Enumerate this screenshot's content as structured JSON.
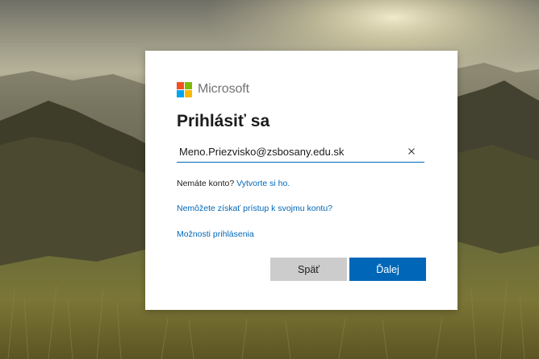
{
  "brand": {
    "name": "Microsoft",
    "logo_colors": [
      "#f25022",
      "#7fba00",
      "#00a4ef",
      "#ffb900"
    ]
  },
  "signin": {
    "title": "Prihlásiť sa",
    "email_value": "Meno.Priezvisko@zsbosany.edu.sk",
    "no_account_text": "Nemáte konto?",
    "create_link": "Vytvorte si ho.",
    "cant_access_link": "Nemôžete získať prístup k svojmu kontu?",
    "signin_options_link": "Možnosti prihlásenia",
    "back_label": "Späť",
    "next_label": "Ďalej"
  },
  "colors": {
    "accent": "#0067b8",
    "secondary_button": "#cccccc"
  }
}
